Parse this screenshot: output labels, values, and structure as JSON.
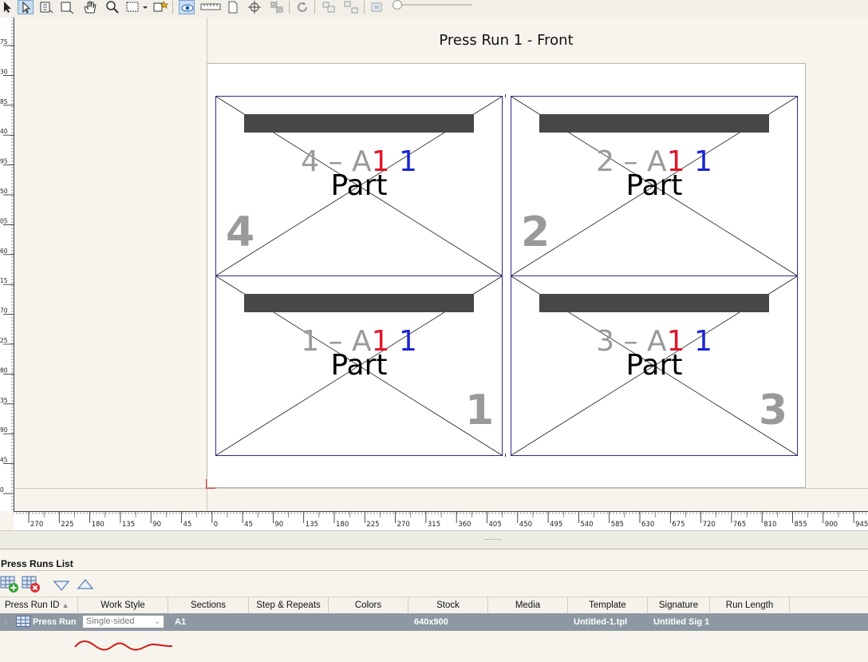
{
  "toolbar": {
    "icons": [
      "select-arrow-icon",
      "direct-select-icon",
      "add-part-icon",
      "resize-icon",
      "pan-hand-icon",
      "zoom-icon",
      "layout-options-icon",
      "auto-imposition-icon",
      "preview-eye-icon",
      "ruler-icon",
      "page-icon",
      "crosshair-icon",
      "align-icon",
      "refresh-icon",
      "group-icon",
      "ungroup-icon",
      "snap-icon"
    ],
    "zoom_level": 0.05
  },
  "sheet": {
    "title": "Press Run 1 - Front"
  },
  "rulers": {
    "vertical_labels": [
      "75",
      "30",
      "85",
      "40",
      "95",
      "50",
      "05",
      "60",
      "15",
      "70",
      "25",
      "80",
      "35",
      "90",
      "45",
      "0"
    ],
    "horizontal_labels": [
      "270",
      "225",
      "180",
      "135",
      "90",
      "45",
      "0",
      "45",
      "90",
      "135",
      "180",
      "225",
      "270",
      "315",
      "360",
      "405",
      "450",
      "495",
      "540",
      "585",
      "630",
      "675",
      "720",
      "765",
      "810",
      "855",
      "900",
      "945",
      "9"
    ]
  },
  "parts": [
    {
      "id": "part-4",
      "prefix": "4 – A",
      "red": "1",
      "blue": "1",
      "word": "Part",
      "big": "4",
      "corner": "bottom-left"
    },
    {
      "id": "part-2",
      "prefix": "2 – A",
      "red": "1",
      "blue": "1",
      "word": "Part",
      "big": "2",
      "corner": "bottom-left"
    },
    {
      "id": "part-1",
      "prefix": "1 – A",
      "red": "1",
      "blue": "1",
      "word": "Part",
      "big": "1",
      "corner": "bottom-right"
    },
    {
      "id": "part-3",
      "prefix": "3 – A",
      "red": "1",
      "blue": "1",
      "word": "Part",
      "big": "3",
      "corner": "bottom-right"
    }
  ],
  "press_runs_list": {
    "title": "Press Runs List",
    "columns": [
      "Press Run ID",
      "Work Style",
      "Sections",
      "Step & Repeats",
      "Colors",
      "Stock",
      "Media",
      "Template",
      "Signature",
      "Run Length"
    ],
    "sort_column": "Press Run ID",
    "rows": [
      {
        "press_run_id": "Press Run",
        "work_style": "Single-sided",
        "sections": "A1",
        "step_repeats": "",
        "colors": "",
        "stock": "640x900",
        "media": "",
        "template": "Untitled-1.tpl",
        "signature": "Untitled Sig 1",
        "run_length": ""
      }
    ]
  },
  "colors": {
    "accent_red": "#e0162a",
    "accent_blue": "#1a24d6",
    "part_border": "#2b2b8a",
    "selected_row": "#8e98a3"
  }
}
